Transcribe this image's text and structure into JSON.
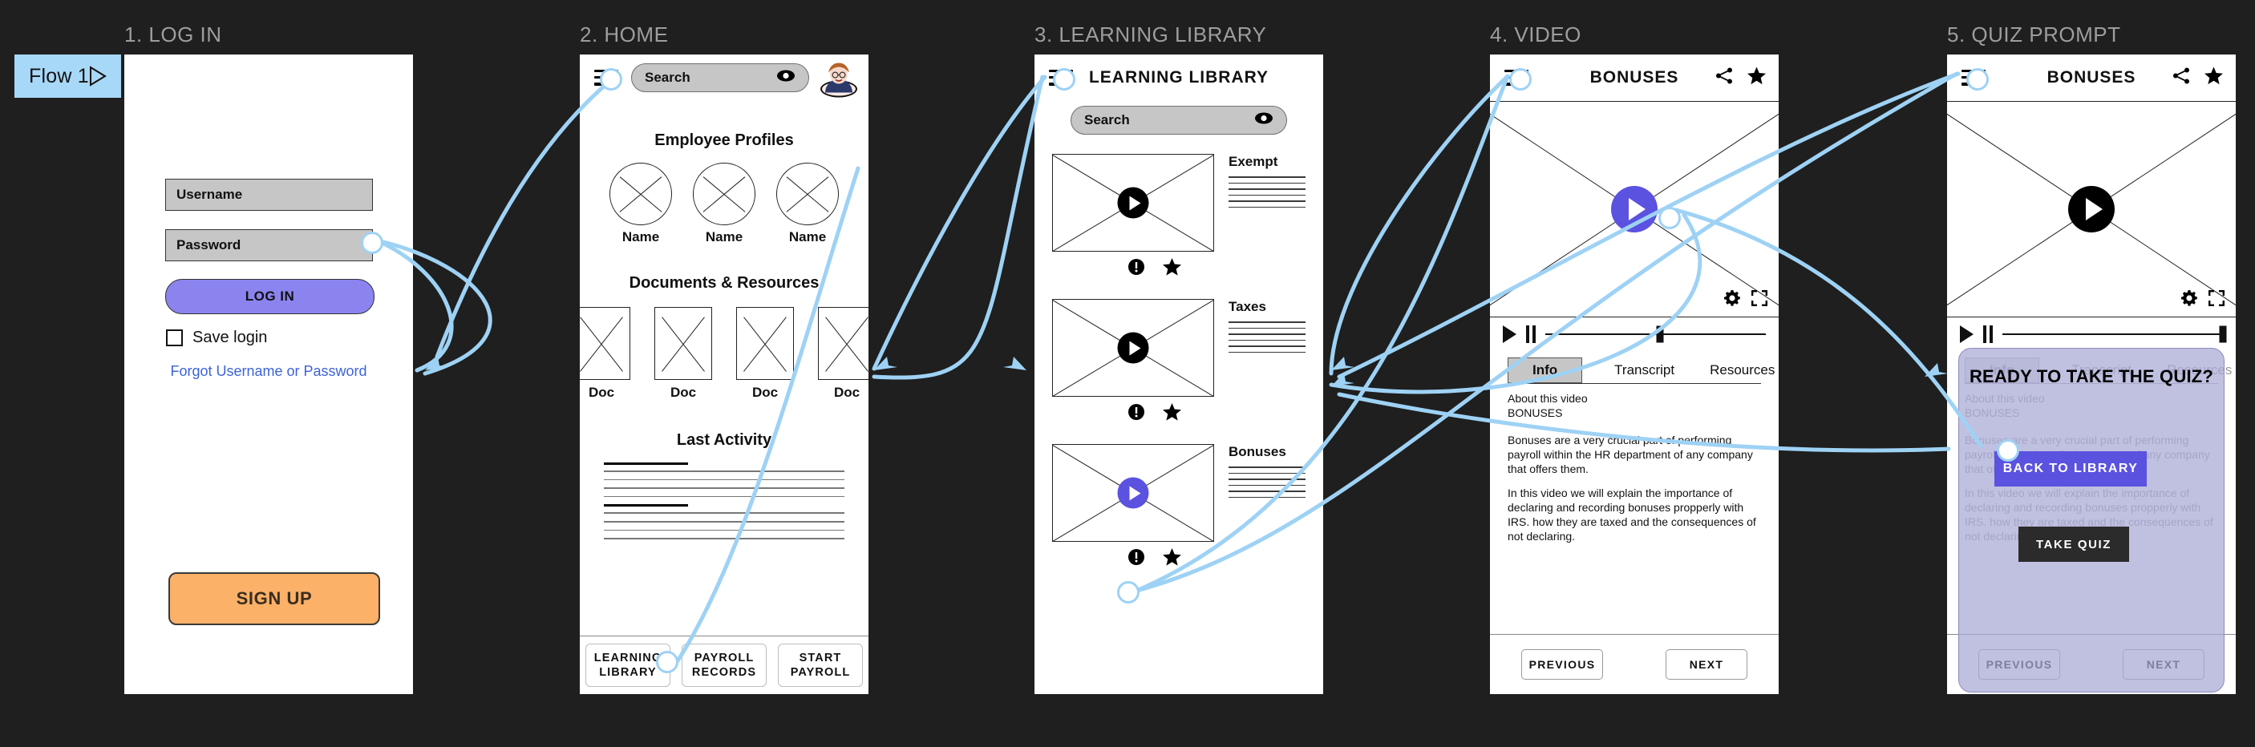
{
  "flow_badge": {
    "label": "Flow 1",
    "icon": "play-triangle-icon"
  },
  "screens": [
    {
      "id": "login",
      "title": "1. LOG IN"
    },
    {
      "id": "home",
      "title": "2. HOME"
    },
    {
      "id": "library",
      "title": "3. LEARNING LIBRARY"
    },
    {
      "id": "video",
      "title": "4. VIDEO"
    },
    {
      "id": "quiz",
      "title": "5. QUIZ PROMPT"
    }
  ],
  "login": {
    "username_value": "Username",
    "password_value": "Password",
    "login_button": "LOG IN",
    "save_login_label": "Save login",
    "save_login_checked": false,
    "forgot_link": "Forgot Username or Password",
    "signup_button": "SIGN UP"
  },
  "home": {
    "search_placeholder": "Search",
    "search_icon": "eye-icon",
    "menu_icon": "hamburger-icon",
    "avatar": "user-avatar",
    "section_profiles": "Employee Profiles",
    "profiles": [
      "Name",
      "Name",
      "Name"
    ],
    "section_documents": "Documents & Resources",
    "documents": [
      "Doc",
      "Doc",
      "Doc",
      "Doc"
    ],
    "section_activity": "Last Activity",
    "nav": [
      {
        "line1": "LEARNING",
        "line2": "LIBRARY"
      },
      {
        "line1": "PAYROLL",
        "line2": "RECORDS"
      },
      {
        "line1": "START",
        "line2": "PAYROLL"
      }
    ]
  },
  "library": {
    "title": "LEARNING LIBRARY",
    "search_placeholder": "Search",
    "search_icon": "eye-icon",
    "cards": [
      {
        "title": "Exempt",
        "play": "play-icon",
        "accent": false,
        "icons": [
          "info-icon",
          "star-icon"
        ]
      },
      {
        "title": "Taxes",
        "play": "play-icon",
        "accent": false,
        "icons": [
          "info-icon",
          "star-icon"
        ]
      },
      {
        "title": "Bonuses",
        "play": "play-icon",
        "accent": true,
        "icons": [
          "info-icon",
          "star-icon"
        ]
      }
    ]
  },
  "video": {
    "title": "BONUSES",
    "share_icon": "share-icon",
    "star_icon": "star-icon",
    "settings_icon": "gear-icon",
    "fullscreen_icon": "fullscreen-icon",
    "play_accent": true,
    "scrub_position_pct": 52,
    "tabs": [
      {
        "label": "Info",
        "active": true
      },
      {
        "label": "Transcript",
        "active": false
      },
      {
        "label": "Resources",
        "active": false
      }
    ],
    "about_label": "About this video",
    "about_subject": "BONUSES",
    "paragraph_1": "Bonuses are a very crucial part of performing payroll within the HR department of any company that offers them.",
    "paragraph_2": "In this video we will explain the importance of declaring and recording bonuses propperly with IRS. how they are taxed and the consequences of not declaring.",
    "previous_button": "PREVIOUS",
    "next_button": "NEXT"
  },
  "quiz": {
    "title": "BONUSES",
    "share_icon": "share-icon",
    "star_icon": "star-icon",
    "settings_icon": "gear-icon",
    "fullscreen_icon": "fullscreen-icon",
    "play_accent": false,
    "scrub_position_pct": 100,
    "overlay_heading": "READY TO TAKE THE QUIZ?",
    "back_to_library_button": "BACK TO LIBRARY",
    "take_quiz_button": "TAKE QUIZ",
    "previous_button": "PREVIOUS",
    "next_button": "NEXT",
    "behind_about_label": "About this video",
    "behind_subject": "BONUSES",
    "behind_paragraph_1": "Bonuses are a very crucial part of performing payroll within the HR department of any company that offers them.",
    "behind_paragraph_2": "In this video we will explain the importance of declaring and recording bonuses propperly with IRS. how they are taxed and the consequences of not declaring."
  },
  "colors": {
    "background": "#1f1f1f",
    "flow_badge": "#a8d8f7",
    "connector": "#9ed2f5",
    "primary": "#8b84ef",
    "accent_play": "#5b52e0",
    "signup": "#fbb168",
    "field": "#c6c6c6",
    "link": "#3d63d8",
    "overlay": "#a7a7d6"
  }
}
